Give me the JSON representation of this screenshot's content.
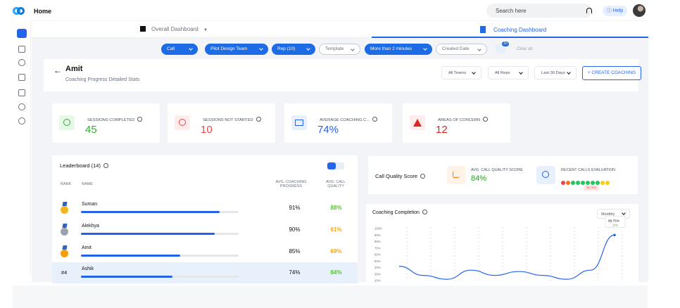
{
  "app": {
    "title": "Home"
  },
  "header": {
    "search_placeholder": "Search here",
    "help_label": "Help"
  },
  "tabs": [
    {
      "label": "Overall Dashboard"
    },
    {
      "label": "Coaching Dashboard"
    }
  ],
  "filters": {
    "items": [
      {
        "label": "Call",
        "variant": "filled"
      },
      {
        "label": "Pilot Design Team",
        "variant": "filled"
      },
      {
        "label": "Rep (10)",
        "variant": "filled"
      },
      {
        "label": "Template",
        "variant": "outline"
      },
      {
        "label": "More than 2 minutes",
        "variant": "filled"
      },
      {
        "label": "Created Date",
        "variant": "outline"
      }
    ],
    "badge_count": "10",
    "clear_label": "Clear all"
  },
  "profile": {
    "name": "Amit",
    "subtitle": "Coaching Progress Detailed Stats",
    "selects": [
      {
        "label": "All Teams"
      },
      {
        "label": "All Reps"
      },
      {
        "label": "Last 30 Days"
      }
    ],
    "create_label": "+ CREATE COACHING"
  },
  "stats": [
    {
      "label": "SESSIONS COMPLETED",
      "value": "45",
      "color": "#2eaf30",
      "icon_bg": "#e7f8e8",
      "icon": "check-circle-icon"
    },
    {
      "label": "SESSIONS NOT STARTED",
      "value": "10",
      "color": "#ef4444",
      "icon_bg": "#ffecec",
      "icon": "blocked-icon"
    },
    {
      "label": "AVERAGE COACHING C...",
      "value": "74%",
      "color": "#2563eb",
      "icon_bg": "#e8f0fb",
      "icon": "book-icon"
    },
    {
      "label": "AREAS OF CONCERN",
      "value": "12",
      "color": "#dc2626",
      "icon_bg": "#ffecec",
      "icon": "warning-icon"
    }
  ],
  "leaderboard": {
    "title": "Leaderboard (14)",
    "headers": {
      "rank": "RANK",
      "name": "NAME",
      "progress": "AVG. COACHING PROGRESS",
      "quality": "AVG. CALL QUALITY"
    },
    "rows": [
      {
        "rank": "",
        "medal": "gold",
        "name": "Suman",
        "progress_pct": 0.88,
        "progress_text": "91%",
        "quality": "88%",
        "quality_color": "#58c533"
      },
      {
        "rank": "",
        "medal": "silver",
        "name": "Alekhya",
        "progress_pct": 0.85,
        "progress_text": "90%",
        "quality": "61%",
        "quality_color": "#f1a51a"
      },
      {
        "rank": "",
        "medal": "bronze",
        "name": "Amit",
        "progress_pct": 0.63,
        "progress_text": "85%",
        "quality": "69%",
        "quality_color": "#f1a51a"
      },
      {
        "rank": "#4",
        "medal": "",
        "name": "Ashik",
        "progress_pct": 0.58,
        "progress_text": "74%",
        "quality": "84%",
        "quality_color": "#58c533"
      }
    ]
  },
  "quality": {
    "title": "Call Quality Score",
    "avg_label": "AVG. CALL QUALITY SCORE",
    "avg_value": "84%",
    "recent_label": "RECENT CALLS EVALUATION",
    "recent_dots": [
      "#ef4444",
      "#f97316",
      "#22c55e",
      "#22c55e",
      "#22c55e",
      "#22c55e",
      "#22c55e",
      "#22c55e",
      "#facc15",
      "#facc15"
    ],
    "warning": "38.75%"
  },
  "chart_data": {
    "type": "line",
    "title": "Coaching Completion",
    "period": "Monthly",
    "y_ticks": [
      "100%",
      "90%",
      "80%",
      "70%",
      "60%",
      "50%",
      "40%",
      "30%",
      "20%"
    ],
    "ylim": [
      20,
      100
    ],
    "x": [
      0,
      1,
      2,
      3,
      4,
      5,
      6,
      7,
      8,
      9
    ],
    "values": [
      42,
      28,
      22,
      36,
      28,
      34,
      28,
      22,
      36,
      90
    ],
    "tooltip": {
      "value": "89.75%",
      "change": "12%"
    }
  }
}
